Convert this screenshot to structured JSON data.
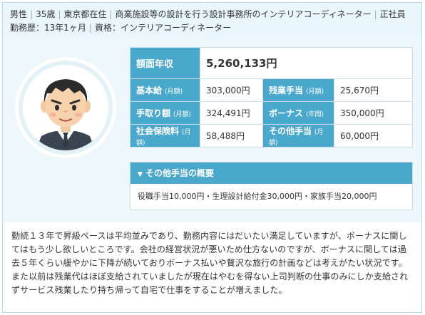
{
  "header": {
    "gender": "男性",
    "age": "35歳",
    "location": "東京都在住",
    "job": "商業施設等の設計を行う設計事務所のインテリアコーディネーター",
    "employment": "正社員",
    "tenure_label": "勤務歴：13年1ヶ月",
    "qualification_label": "資格：インテリアコーディネーター"
  },
  "salary": {
    "total_label": "額面年収",
    "total_value": "5,260,133円",
    "rows": [
      {
        "l1": "基本給",
        "l1_note": "(月額)",
        "v1": "303,000円",
        "l2": "残業手当",
        "l2_note": "(月額)",
        "v2": "25,670円"
      },
      {
        "l1": "手取り額",
        "l1_note": "(月額)",
        "v1": "324,491円",
        "l2": "ボーナス",
        "l2_note": "(年間)",
        "v2": "350,000円"
      },
      {
        "l1": "社会保険料",
        "l1_note": "(月額)",
        "v1": "58,488円",
        "l2": "その他手当",
        "l2_note": "(月額)",
        "v2": "60,000円"
      }
    ]
  },
  "other_allowance": {
    "title": "その他手当の概要",
    "text": "役職手当10,000円・生理設計給付金30,000円・家族手当20,000円"
  },
  "comment": "勤続１３年で昇級ペースは平均並みであり、勤務内容にはだいたい満足していますが、ボーナスに関してはもう少し欲しいところです。会社の経営状況が悪いため仕方ないのですが、ボーナスに関しては過去５年くらい緩やかに下降が続いておりボーナス払いや贅沢な旅行の計画などは考えがたい状況です。また以前は残業代はほぼ支給されていましたが現在はやむを得ない上司判断の仕事のみにしか支給されずサービス残業したり持ち帰って自宅で仕事をすることが増えました。",
  "colors": {
    "accent": "#4aa8cc",
    "header_bg": "#e9f6fb",
    "panel_bg": "#eef7fb"
  },
  "icons": {
    "avatar": "businessman-avatar-icon",
    "toggle": "chevron-down-icon"
  }
}
